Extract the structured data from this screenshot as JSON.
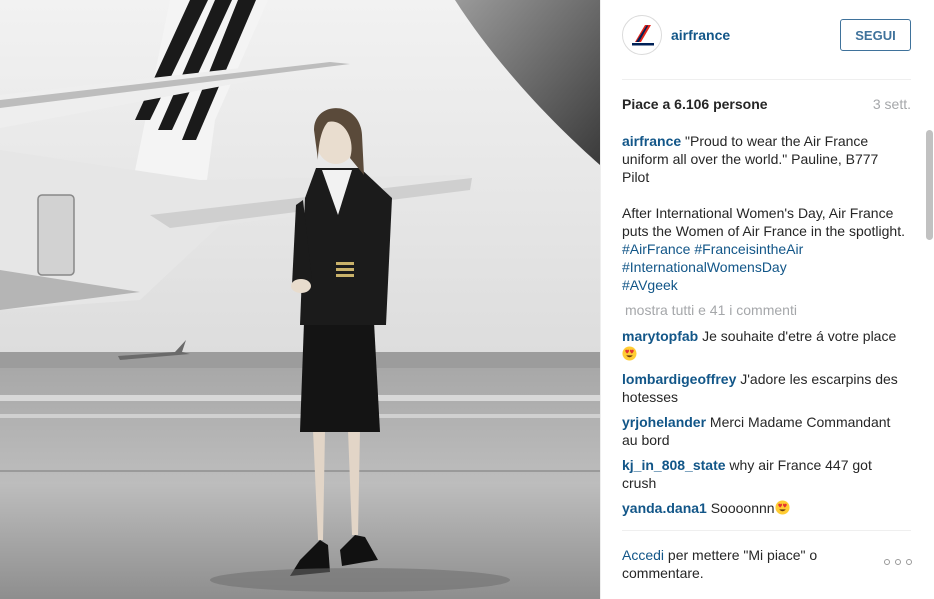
{
  "post": {
    "author": "airfrance",
    "follow_label": "SEGUI",
    "likes_text": "Piace a 6.106 persone",
    "time_text": "3 sett."
  },
  "caption": {
    "user": "airfrance",
    "text1": "\"Proud to wear the Air France uniform all over the world.\" Pauline, B777 Pilot",
    "text2": "After International Women's Day, Air France puts the Women of Air France in the spotlight.",
    "hashtags": [
      "#AirFrance",
      "#FranceisintheAir",
      "#InternationalWomensDay",
      "#AVgeek"
    ]
  },
  "show_all_comments": "mostra tutti e 41 i commenti",
  "comments": [
    {
      "user": "marytopfab",
      "text": "Je souhaite d'etre á votre place",
      "emoji": "heart-eyes"
    },
    {
      "user": "lombardigeoffrey",
      "text": "J'adore les escarpins des hotesses"
    },
    {
      "user": "yrjohelander",
      "text": "Merci Madame Commandant au bord"
    },
    {
      "user": "kj_in_808_state",
      "text": "why air France 447 got crush"
    },
    {
      "user": "yanda.dana1",
      "text": "Soooonnn",
      "emoji": "heart-eyes"
    }
  ],
  "footer": {
    "login_label": "Accedi",
    "rest_text": " per mettere \"Mi piace\" o commentare."
  },
  "icons": {
    "logo": "air-france-logo-icon",
    "more": "more-options-icon",
    "emoji": "heart-eyes-emoji-icon"
  },
  "colors": {
    "link": "#125688",
    "button": "#3f729b",
    "muted": "#a5a7aa",
    "logo_red": "#e1251b",
    "logo_navy": "#002157"
  }
}
